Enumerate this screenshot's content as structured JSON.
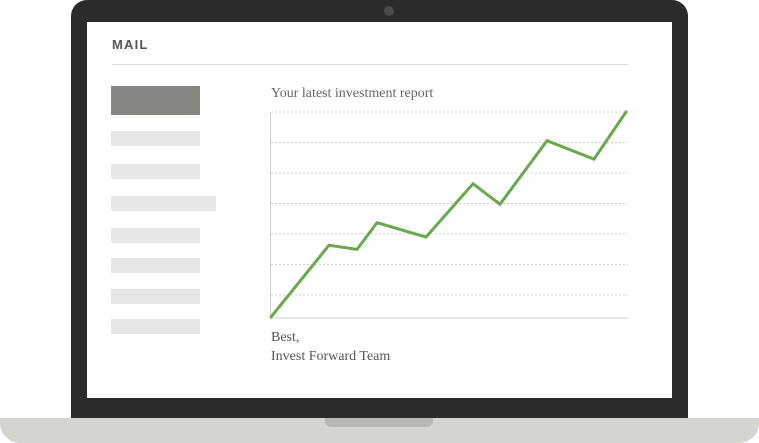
{
  "mail": {
    "title": "MAIL"
  },
  "sidebar": {
    "items": [
      {
        "state": "selected"
      },
      {
        "state": "placeholder"
      },
      {
        "state": "placeholder"
      },
      {
        "state": "placeholder"
      },
      {
        "state": "placeholder"
      },
      {
        "state": "placeholder"
      },
      {
        "state": "placeholder"
      },
      {
        "state": "placeholder"
      }
    ]
  },
  "message": {
    "heading": "Your latest investment report",
    "signoff_line1": "Best,",
    "signoff_line2": "Invest Forward Team"
  },
  "colors": {
    "line": "#6aa84f",
    "frame": "#2b2b2b",
    "base": "#d3d5ce"
  },
  "chart_data": {
    "type": "line",
    "grid": "dashed horizontal",
    "series": [
      {
        "values": [
          0,
          35,
          33,
          46,
          39,
          65,
          55,
          86,
          77,
          100
        ]
      }
    ],
    "ylim": [
      0,
      100
    ]
  }
}
